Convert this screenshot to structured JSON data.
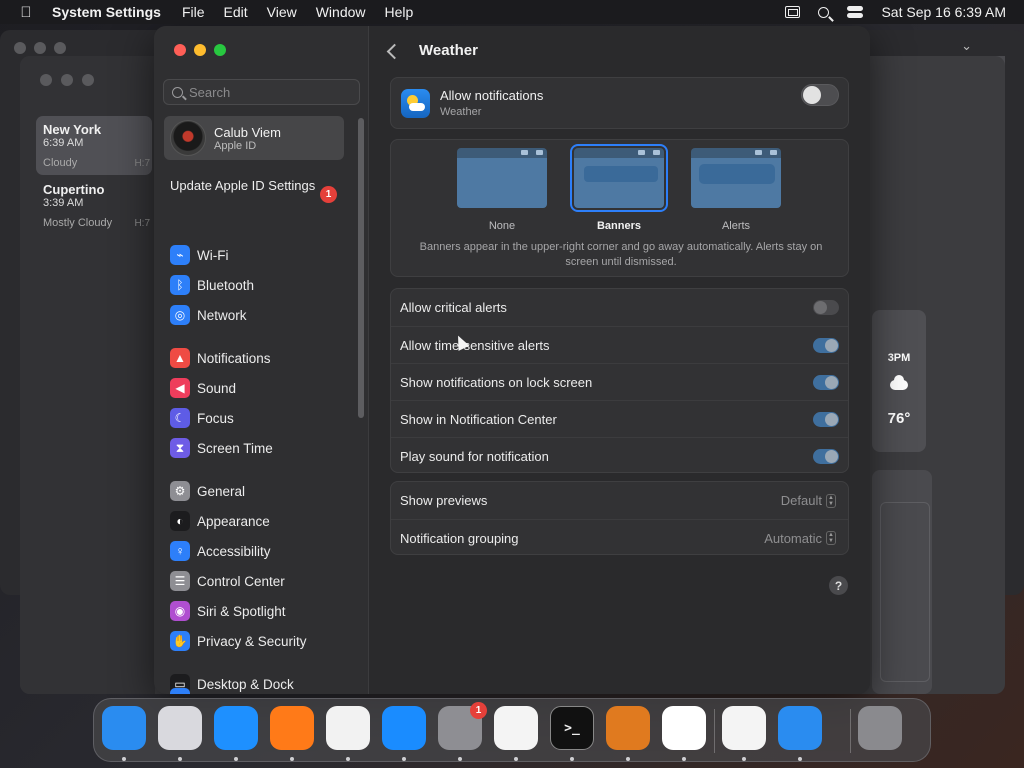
{
  "menubar": {
    "app_name": "System Settings",
    "menus": [
      "File",
      "Edit",
      "View",
      "Window",
      "Help"
    ],
    "clock": "Sat Sep 16  6:39 AM"
  },
  "weather_app": {
    "cities": [
      {
        "name": "New York",
        "time": "6:39 AM",
        "condition": "Cloudy",
        "hl": "H:7"
      },
      {
        "name": "Cupertino",
        "time": "3:39 AM",
        "condition": "Mostly Cloudy",
        "hl": "H:7"
      }
    ],
    "forecast": {
      "hour": "3PM",
      "temp": "76°"
    }
  },
  "sidebar": {
    "search_placeholder": "Search",
    "account": {
      "name": "Calub Viem",
      "subtitle": "Apple ID"
    },
    "update": {
      "label": "Update Apple ID Settings",
      "badge": "1"
    },
    "items": [
      {
        "label": "Wi-Fi",
        "icon": "wifi-icon",
        "color": "#2d7ff9"
      },
      {
        "label": "Bluetooth",
        "icon": "bluetooth-icon",
        "color": "#2d7ff9"
      },
      {
        "label": "Network",
        "icon": "globe-icon",
        "color": "#2d7ff9"
      },
      {
        "label": "Notifications",
        "icon": "bell-icon",
        "color": "#ef4b44"
      },
      {
        "label": "Sound",
        "icon": "speaker-icon",
        "color": "#ee3d5c"
      },
      {
        "label": "Focus",
        "icon": "moon-icon",
        "color": "#5e5ce6"
      },
      {
        "label": "Screen Time",
        "icon": "hourglass-icon",
        "color": "#6e5ce6"
      },
      {
        "label": "General",
        "icon": "gear-icon",
        "color": "#8e8e93"
      },
      {
        "label": "Appearance",
        "icon": "appearance-icon",
        "color": "#1c1c1e"
      },
      {
        "label": "Accessibility",
        "icon": "accessibility-icon",
        "color": "#2d7ff9"
      },
      {
        "label": "Control Center",
        "icon": "control-center-icon",
        "color": "#8e8e93"
      },
      {
        "label": "Siri & Spotlight",
        "icon": "siri-icon",
        "color": "#b04fd0"
      },
      {
        "label": "Privacy & Security",
        "icon": "hand-icon",
        "color": "#2d7ff9"
      },
      {
        "label": "Desktop & Dock",
        "icon": "dock-icon",
        "color": "#1c1c1e"
      }
    ]
  },
  "content": {
    "title": "Weather",
    "allow": {
      "title": "Allow notifications",
      "subtitle": "Weather",
      "on": false
    },
    "styles": [
      {
        "label": "None",
        "selected": false
      },
      {
        "label": "Banners",
        "selected": true
      },
      {
        "label": "Alerts",
        "selected": false
      }
    ],
    "style_description": "Banners appear in the upper-right corner and go away automatically. Alerts stay on screen until dismissed.",
    "toggles": [
      {
        "label": "Allow critical alerts",
        "on": false
      },
      {
        "label": "Allow time-sensitive alerts",
        "on": true
      },
      {
        "label": "Show notifications on lock screen",
        "on": true
      },
      {
        "label": "Show in Notification Center",
        "on": true
      },
      {
        "label": "Play sound for notification",
        "on": true
      }
    ],
    "popups": [
      {
        "label": "Show previews",
        "value": "Default"
      },
      {
        "label": "Notification grouping",
        "value": "Automatic"
      }
    ],
    "help": "?"
  },
  "dock": {
    "apps": [
      {
        "name": "finder-icon",
        "color": "#2a8cf0"
      },
      {
        "name": "launchpad-icon",
        "color": "#d9d9de"
      },
      {
        "name": "safari-icon",
        "color": "#1e90ff"
      },
      {
        "name": "firefox-icon",
        "color": "#ff7a18"
      },
      {
        "name": "chrome-icon",
        "color": "#f2f2f2"
      },
      {
        "name": "app-store-icon",
        "color": "#1a8cff"
      },
      {
        "name": "system-settings-icon",
        "color": "#8e8e93",
        "badge": "1"
      },
      {
        "name": "textedit-icon",
        "color": "#f4f4f4"
      },
      {
        "name": "terminal-icon",
        "color": "#111111",
        "glyph": ">_"
      },
      {
        "name": "garageband-icon",
        "color": "#e07a1f"
      },
      {
        "name": "vscode-icon",
        "color": "#ffffff"
      },
      {
        "name": "visual-studio-icon",
        "color": "#f4f4f4"
      },
      {
        "name": "weather-icon",
        "color": "#2a8cf0"
      },
      {
        "name": "trash-icon",
        "color": "#8a8a8e"
      }
    ]
  }
}
